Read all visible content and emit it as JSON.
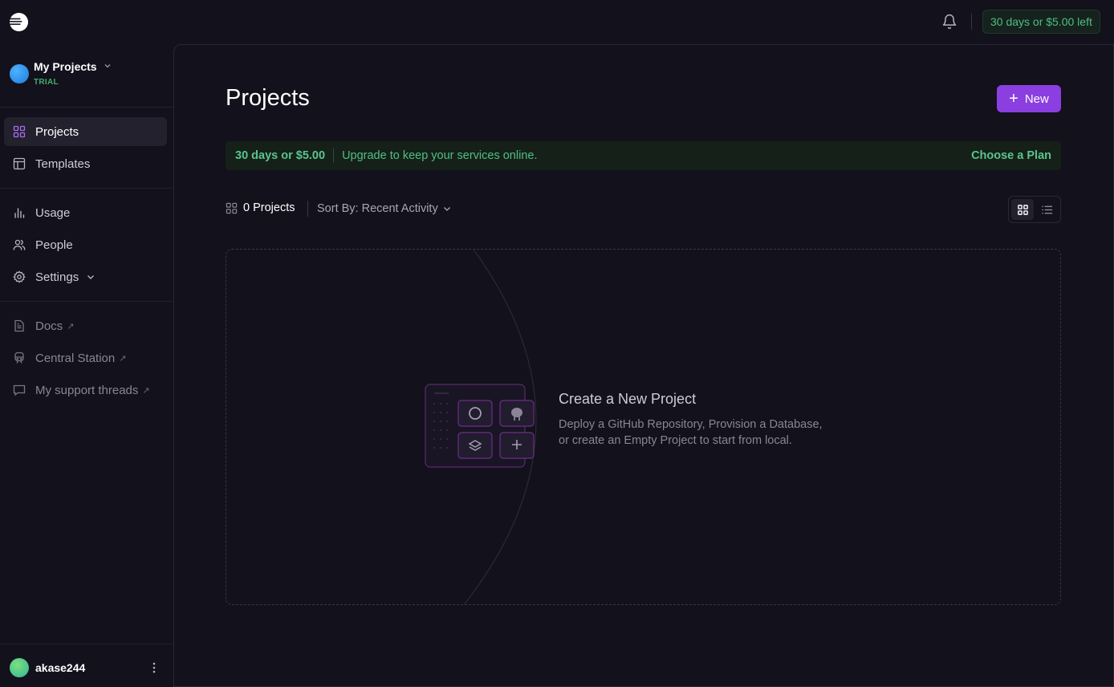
{
  "topbar": {
    "logo_icon": "railway-logo-icon",
    "bell_icon": "bell-icon",
    "trial_pill": "30 days or $5.00 left"
  },
  "sidebar": {
    "workspace": {
      "name": "My Projects",
      "plan": "TRIAL"
    },
    "primary": [
      {
        "label": "Projects",
        "icon": "grid-icon",
        "active": true
      },
      {
        "label": "Templates",
        "icon": "layout-icon",
        "active": false
      }
    ],
    "secondary": [
      {
        "label": "Usage",
        "icon": "bar-chart-icon"
      },
      {
        "label": "People",
        "icon": "users-icon"
      },
      {
        "label": "Settings",
        "icon": "gear-icon"
      }
    ],
    "links": [
      {
        "label": "Docs",
        "icon": "document-icon",
        "external": "↗"
      },
      {
        "label": "Central Station",
        "icon": "train-icon",
        "external": "↗"
      },
      {
        "label": "My support threads",
        "icon": "message-icon",
        "external": "↗"
      }
    ],
    "user": {
      "name": "akase244"
    }
  },
  "main": {
    "title": "Projects",
    "new_button": "New",
    "banner": {
      "strong": "30 days or $5.00",
      "message": "Upgrade to keep your services online.",
      "cta": "Choose a Plan"
    },
    "toolbar": {
      "count": "0 Projects",
      "sort": "Sort By: Recent Activity"
    },
    "empty": {
      "title": "Create a New Project",
      "line1": "Deploy a GitHub Repository, Provision a Database,",
      "line2": "or create an Empty Project to start from local."
    }
  },
  "colors": {
    "background": "#13111c",
    "accent": "#8b3fe0",
    "success": "#4fbf83"
  }
}
